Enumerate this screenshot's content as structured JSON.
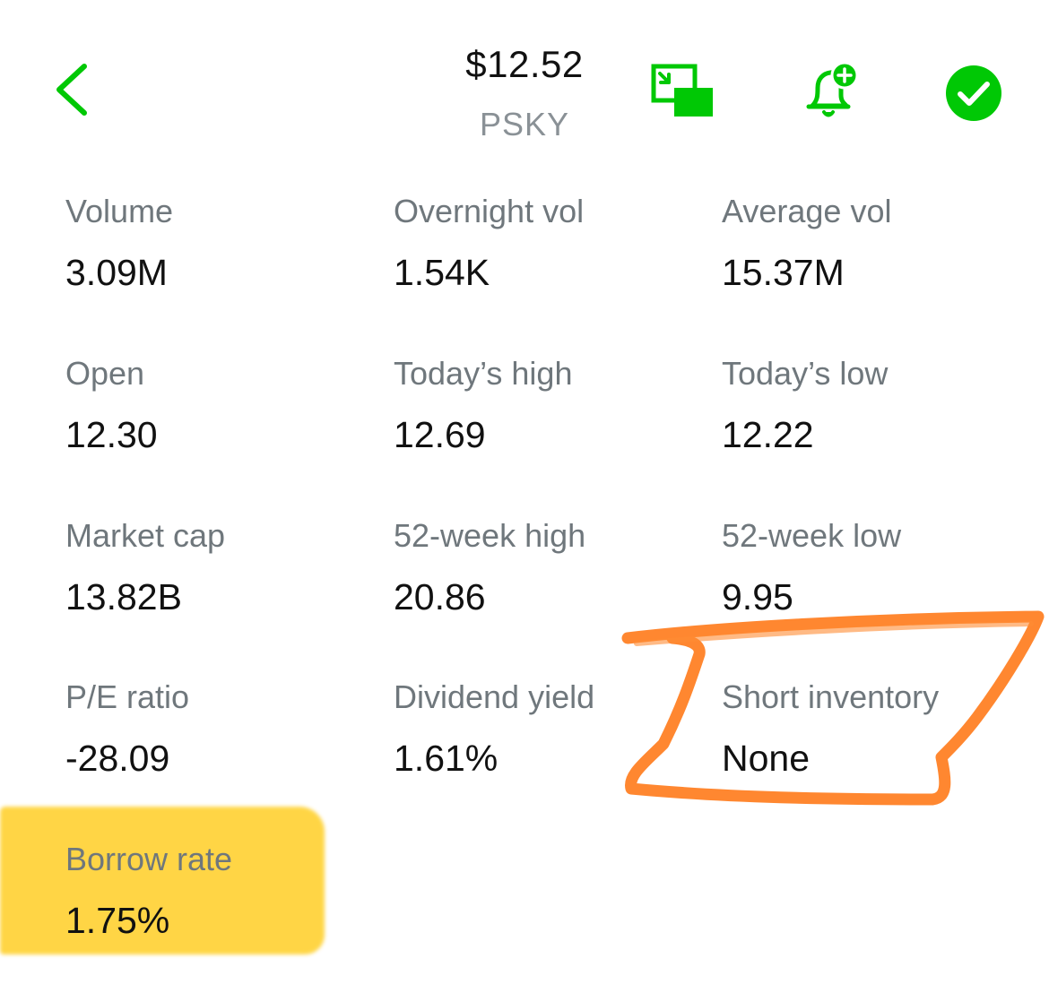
{
  "header": {
    "price": "$12.52",
    "ticker": "PSKY"
  },
  "icons": {
    "back": "chevron-left-icon",
    "pip": "picture-in-picture-icon",
    "alert": "bell-plus-icon",
    "watch": "check-circle-icon"
  },
  "colors": {
    "accent": "#00c805",
    "label": "#6f777c",
    "value": "#111111",
    "highlight": "#ffd02c",
    "scribble": "#ff7a1a"
  },
  "stats": [
    {
      "label": "Volume",
      "value": "3.09M"
    },
    {
      "label": "Overnight vol",
      "value": "1.54K"
    },
    {
      "label": "Average vol",
      "value": "15.37M"
    },
    {
      "label": "Open",
      "value": "12.30"
    },
    {
      "label": "Today’s high",
      "value": "12.69"
    },
    {
      "label": "Today’s low",
      "value": "12.22"
    },
    {
      "label": "Market cap",
      "value": "13.82B"
    },
    {
      "label": "52-week high",
      "value": "20.86"
    },
    {
      "label": "52-week low",
      "value": "9.95"
    },
    {
      "label": "P/E ratio",
      "value": "-28.09"
    },
    {
      "label": "Dividend yield",
      "value": "1.61%"
    },
    {
      "label": "Short inventory",
      "value": "None"
    },
    {
      "label": "Borrow rate",
      "value": "1.75%"
    }
  ]
}
